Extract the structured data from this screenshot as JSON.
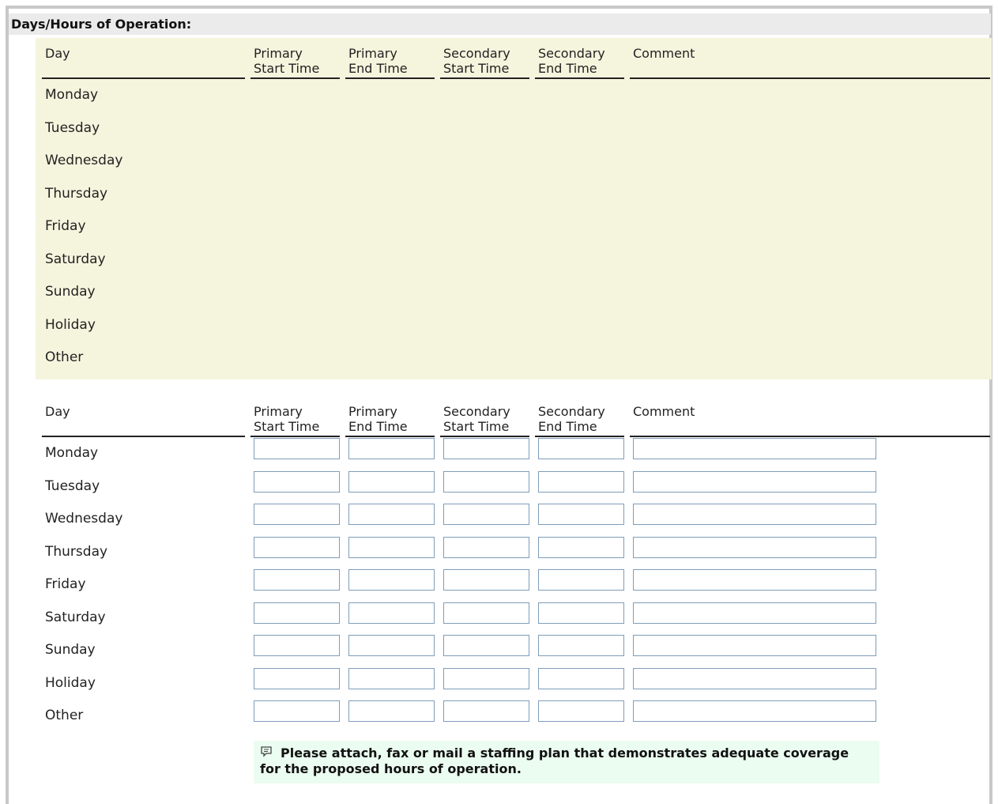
{
  "section": {
    "title": "Days/Hours of Operation:"
  },
  "columns": {
    "day": "Day",
    "primary_start": [
      "Primary",
      "Start Time"
    ],
    "primary_end": [
      "Primary",
      "End Time"
    ],
    "secondary_start": [
      "Secondary",
      "Start Time"
    ],
    "secondary_end": [
      "Secondary",
      "End Time"
    ],
    "comment": "Comment"
  },
  "days": [
    "Monday",
    "Tuesday",
    "Wednesday",
    "Thursday",
    "Friday",
    "Saturday",
    "Sunday",
    "Holiday",
    "Other"
  ],
  "readonly_table": {
    "rows": [
      {
        "day": "Monday",
        "primary_start": "",
        "primary_end": "",
        "secondary_start": "",
        "secondary_end": "",
        "comment": ""
      },
      {
        "day": "Tuesday",
        "primary_start": "",
        "primary_end": "",
        "secondary_start": "",
        "secondary_end": "",
        "comment": ""
      },
      {
        "day": "Wednesday",
        "primary_start": "",
        "primary_end": "",
        "secondary_start": "",
        "secondary_end": "",
        "comment": ""
      },
      {
        "day": "Thursday",
        "primary_start": "",
        "primary_end": "",
        "secondary_start": "",
        "secondary_end": "",
        "comment": ""
      },
      {
        "day": "Friday",
        "primary_start": "",
        "primary_end": "",
        "secondary_start": "",
        "secondary_end": "",
        "comment": ""
      },
      {
        "day": "Saturday",
        "primary_start": "",
        "primary_end": "",
        "secondary_start": "",
        "secondary_end": "",
        "comment": ""
      },
      {
        "day": "Sunday",
        "primary_start": "",
        "primary_end": "",
        "secondary_start": "",
        "secondary_end": "",
        "comment": ""
      },
      {
        "day": "Holiday",
        "primary_start": "",
        "primary_end": "",
        "secondary_start": "",
        "secondary_end": "",
        "comment": ""
      },
      {
        "day": "Other",
        "primary_start": "",
        "primary_end": "",
        "secondary_start": "",
        "secondary_end": "",
        "comment": ""
      }
    ]
  },
  "edit_table": {
    "rows": [
      {
        "day": "Monday",
        "primary_start": "",
        "primary_end": "",
        "secondary_start": "",
        "secondary_end": "",
        "comment": ""
      },
      {
        "day": "Tuesday",
        "primary_start": "",
        "primary_end": "",
        "secondary_start": "",
        "secondary_end": "",
        "comment": ""
      },
      {
        "day": "Wednesday",
        "primary_start": "",
        "primary_end": "",
        "secondary_start": "",
        "secondary_end": "",
        "comment": ""
      },
      {
        "day": "Thursday",
        "primary_start": "",
        "primary_end": "",
        "secondary_start": "",
        "secondary_end": "",
        "comment": ""
      },
      {
        "day": "Friday",
        "primary_start": "",
        "primary_end": "",
        "secondary_start": "",
        "secondary_end": "",
        "comment": ""
      },
      {
        "day": "Saturday",
        "primary_start": "",
        "primary_end": "",
        "secondary_start": "",
        "secondary_end": "",
        "comment": ""
      },
      {
        "day": "Sunday",
        "primary_start": "",
        "primary_end": "",
        "secondary_start": "",
        "secondary_end": "",
        "comment": ""
      },
      {
        "day": "Holiday",
        "primary_start": "",
        "primary_end": "",
        "secondary_start": "",
        "secondary_end": "",
        "comment": ""
      },
      {
        "day": "Other",
        "primary_start": "",
        "primary_end": "",
        "secondary_start": "",
        "secondary_end": "",
        "comment": ""
      }
    ]
  },
  "note": {
    "icon": "speech-bubble-icon",
    "text": "Please attach, fax or mail a staffing plan that demonstrates adequate coverage for the proposed hours of operation."
  },
  "colors": {
    "header_bg": "#ebebeb",
    "readonly_panel_bg": "#f5f5de",
    "note_bg": "#ebfcf0",
    "input_border": "#7f9db9"
  }
}
